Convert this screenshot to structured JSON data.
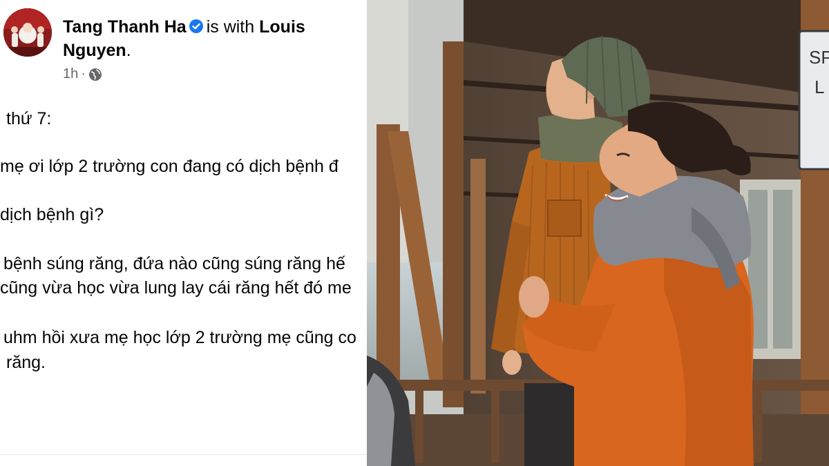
{
  "post": {
    "author": "Tang Thanh Ha",
    "with_text": "is with",
    "tagged": "Louis Nguyen",
    "period": ".",
    "time": "1h",
    "separator": "·",
    "icons": {
      "verified": "verified-badge-icon",
      "audience": "globe-icon"
    },
    "body_lines": [
      "thứ 7:",
      "mẹ ơi lớp 2 trường con đang có dịch bệnh đ",
      "dịch bệnh gì?",
      "bệnh súng răng, đứa nào cũng súng răng hế",
      "cũng vừa học vừa lung lay cái răng hết đó me",
      "uhm hồi xưa mẹ học lớp 2 trường mẹ cũng co",
      "răng."
    ]
  },
  "photo": {
    "sign_text": [
      "SP",
      "L"
    ]
  },
  "colors": {
    "text": "#050505",
    "meta": "#65676b",
    "verified": "#1877f2",
    "jacket_orange": "#d9661f",
    "corduroy": "#b8661e",
    "beanie": "#5f6a55"
  }
}
